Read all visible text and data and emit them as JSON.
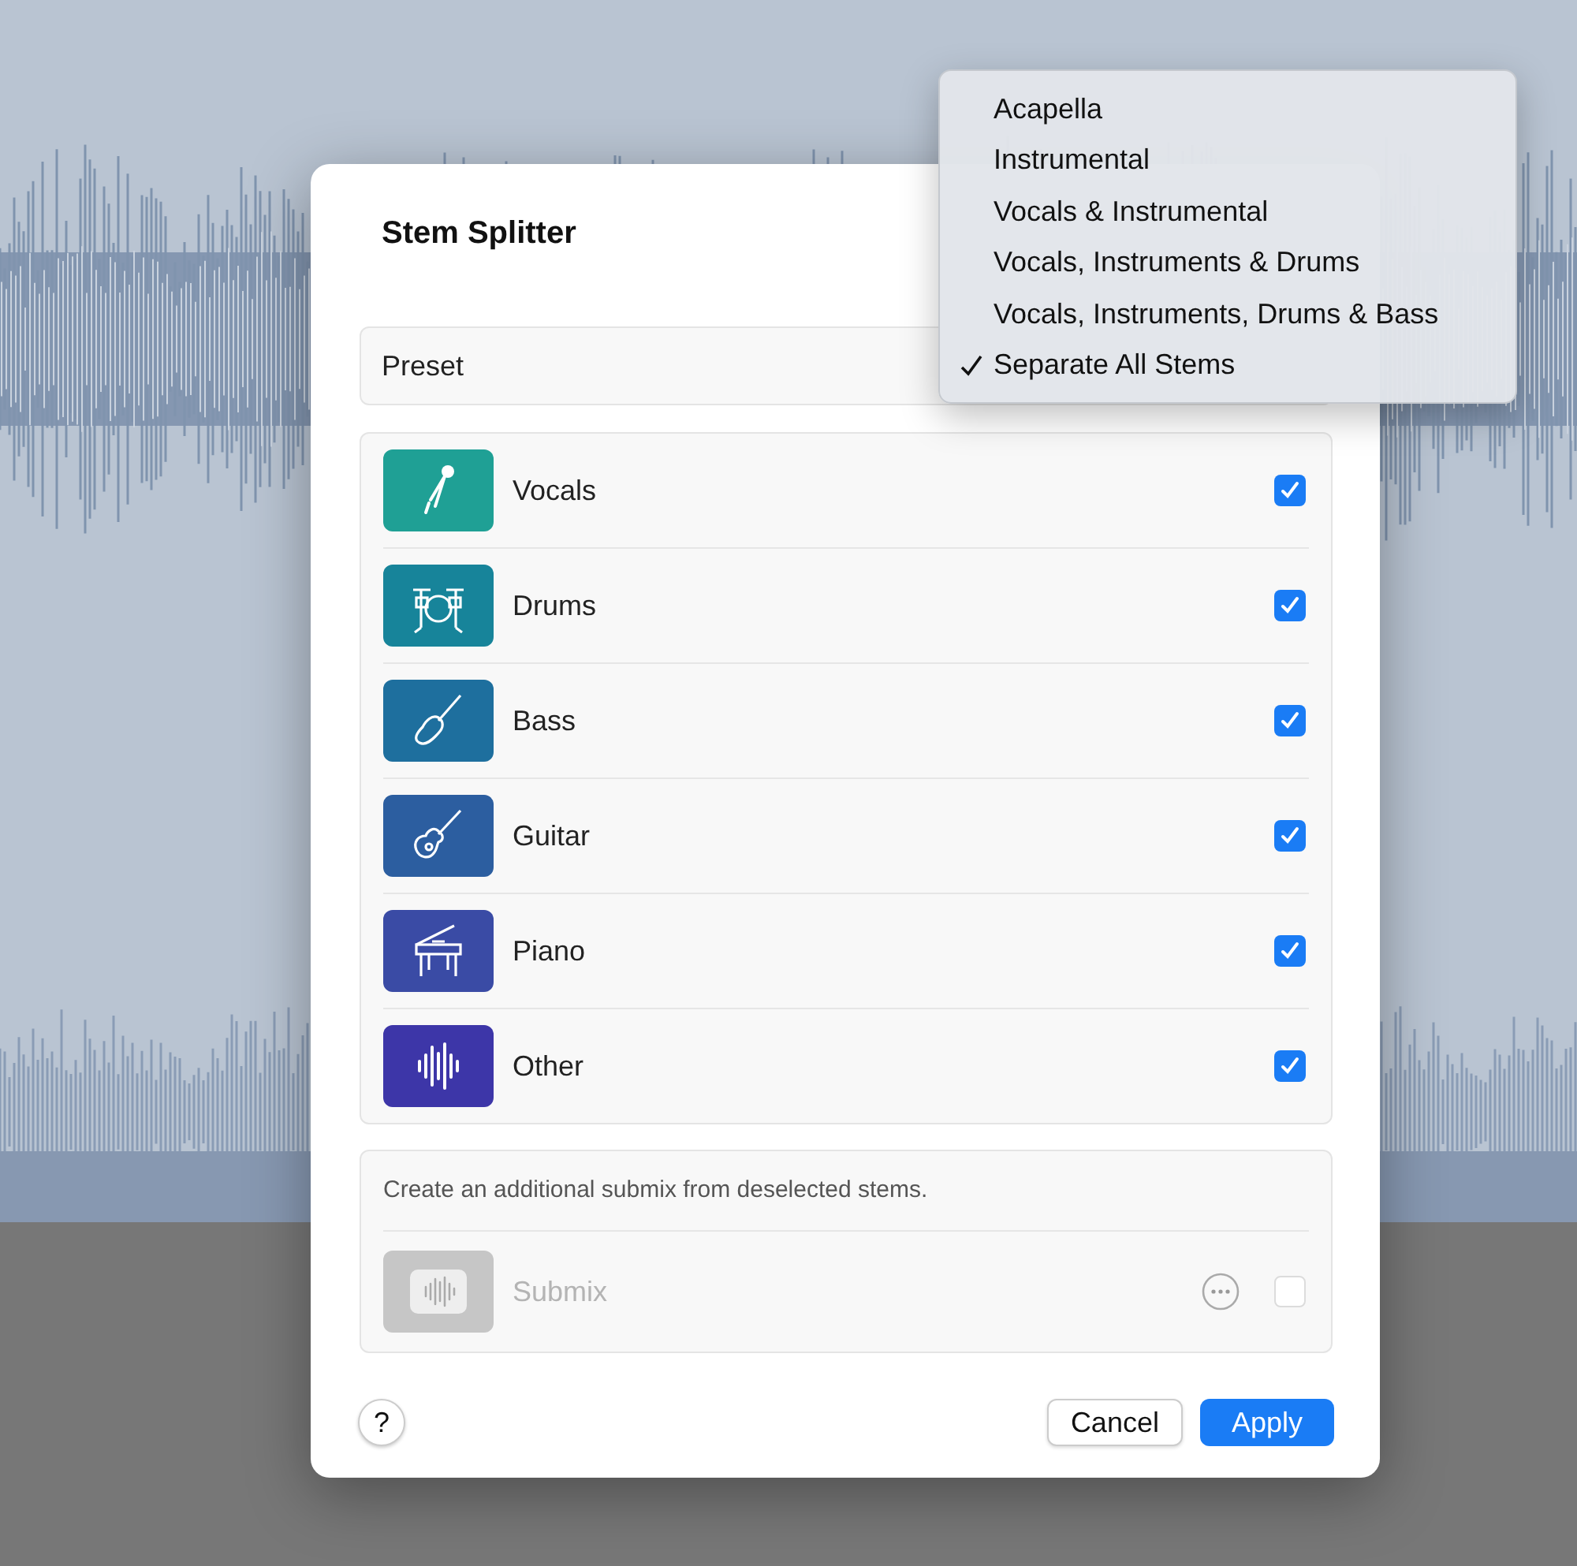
{
  "dialog": {
    "title": "Stem Splitter",
    "preset": {
      "label": "Preset"
    },
    "stems": [
      {
        "kind": "vocals",
        "name": "Vocals",
        "color": "#1fa095",
        "checked": true
      },
      {
        "kind": "drums",
        "name": "Drums",
        "color": "#17849a",
        "checked": true
      },
      {
        "kind": "bass",
        "name": "Bass",
        "color": "#1e6f9e",
        "checked": true
      },
      {
        "kind": "guitar",
        "name": "Guitar",
        "color": "#2c5ea0",
        "checked": true
      },
      {
        "kind": "piano",
        "name": "Piano",
        "color": "#3a4ba5",
        "checked": true
      },
      {
        "kind": "other",
        "name": "Other",
        "color": "#3d36a8",
        "checked": true
      }
    ],
    "submix": {
      "description": "Create an additional submix from deselected stems.",
      "name": "Submix",
      "disabled": true,
      "checked": false
    },
    "buttons": [
      {
        "kind": "help",
        "label": "?"
      },
      {
        "kind": "secondary",
        "label": "Cancel"
      },
      {
        "kind": "primary",
        "label": "Apply"
      }
    ]
  },
  "preset_menu": {
    "items": [
      {
        "label": "Acapella",
        "selected": false
      },
      {
        "label": "Instrumental",
        "selected": false
      },
      {
        "label": "Vocals & Instrumental",
        "selected": false
      },
      {
        "label": "Vocals, Instruments & Drums",
        "selected": false
      },
      {
        "label": "Vocals, Instruments, Drums & Bass",
        "selected": false
      },
      {
        "label": "Separate All Stems",
        "selected": true
      }
    ]
  }
}
